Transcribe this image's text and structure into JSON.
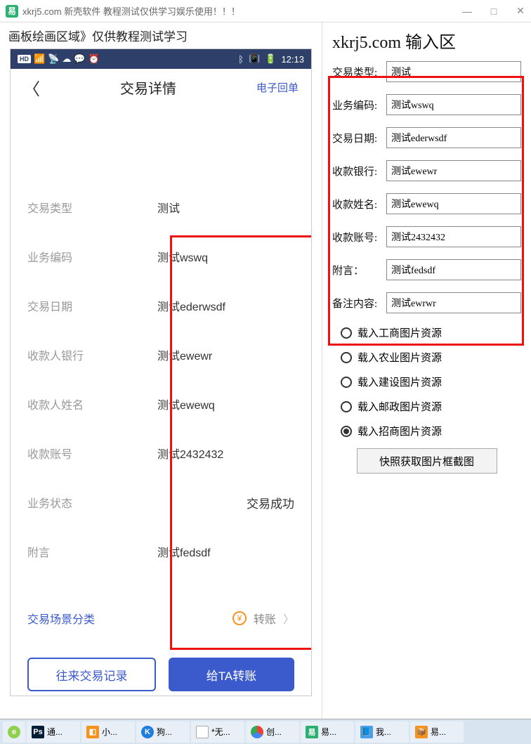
{
  "titlebar": {
    "app_icon_text": "易",
    "title": "xkrj5.com 新壳软件  教程测试仅供学习娱乐使用！！！"
  },
  "left": {
    "header": "画板绘画区域》仅供教程测试学习",
    "status": {
      "hd": "HD",
      "time": "12:13"
    },
    "phone_header": {
      "title": "交易详情",
      "receipt": "电子回单"
    },
    "rows": {
      "type_label": "交易类型",
      "type_value": "测试",
      "code_label": "业务编码",
      "code_value": "测试wswq",
      "date_label": "交易日期",
      "date_value": "测试ederwsdf",
      "bank_label": "收款人银行",
      "bank_value": "测试ewewr",
      "name_label": "收款人姓名",
      "name_value": "测试ewewq",
      "acct_label": "收款账号",
      "acct_value": "测试2432432",
      "status_label": "业务状态",
      "status_value": "交易成功",
      "memo_label": "附言",
      "memo_value": "测试fedsdf",
      "scene_label": "交易场景分类",
      "scene_value": "转账"
    },
    "buttons": {
      "history": "往来交易记录",
      "transfer": "给TA转账"
    }
  },
  "right": {
    "title": "xkrj5.com 输入区",
    "fields": {
      "type_label": "交易类型:",
      "type_value": "测试",
      "code_label": "业务编码:",
      "code_value": "测试wswq",
      "date_label": "交易日期:",
      "date_value": "测试ederwsdf",
      "bank_label": "收款银行:",
      "bank_value": "测试ewewr",
      "name_label": "收款姓名:",
      "name_value": "测试ewewq",
      "acct_label": "收款账号:",
      "acct_value": "测试2432432",
      "memo_label": "附言：",
      "memo_value": "测试fedsdf",
      "note_label": "备注内容:",
      "note_value": "测试ewrwr"
    },
    "radios": {
      "icbc": "载入工商图片资源",
      "abc": "载入农业图片资源",
      "ccb": "载入建设图片资源",
      "post": "载入邮政图片资源",
      "cmb": "载入招商图片资源"
    },
    "snapshot": "快照获取图片框截图"
  },
  "taskbar": {
    "t1": "通...",
    "t2": "小...",
    "t3": "狗...",
    "t4": "*无...",
    "t5": "创...",
    "t6": "易...",
    "t7": "我...",
    "t8": "易..."
  }
}
